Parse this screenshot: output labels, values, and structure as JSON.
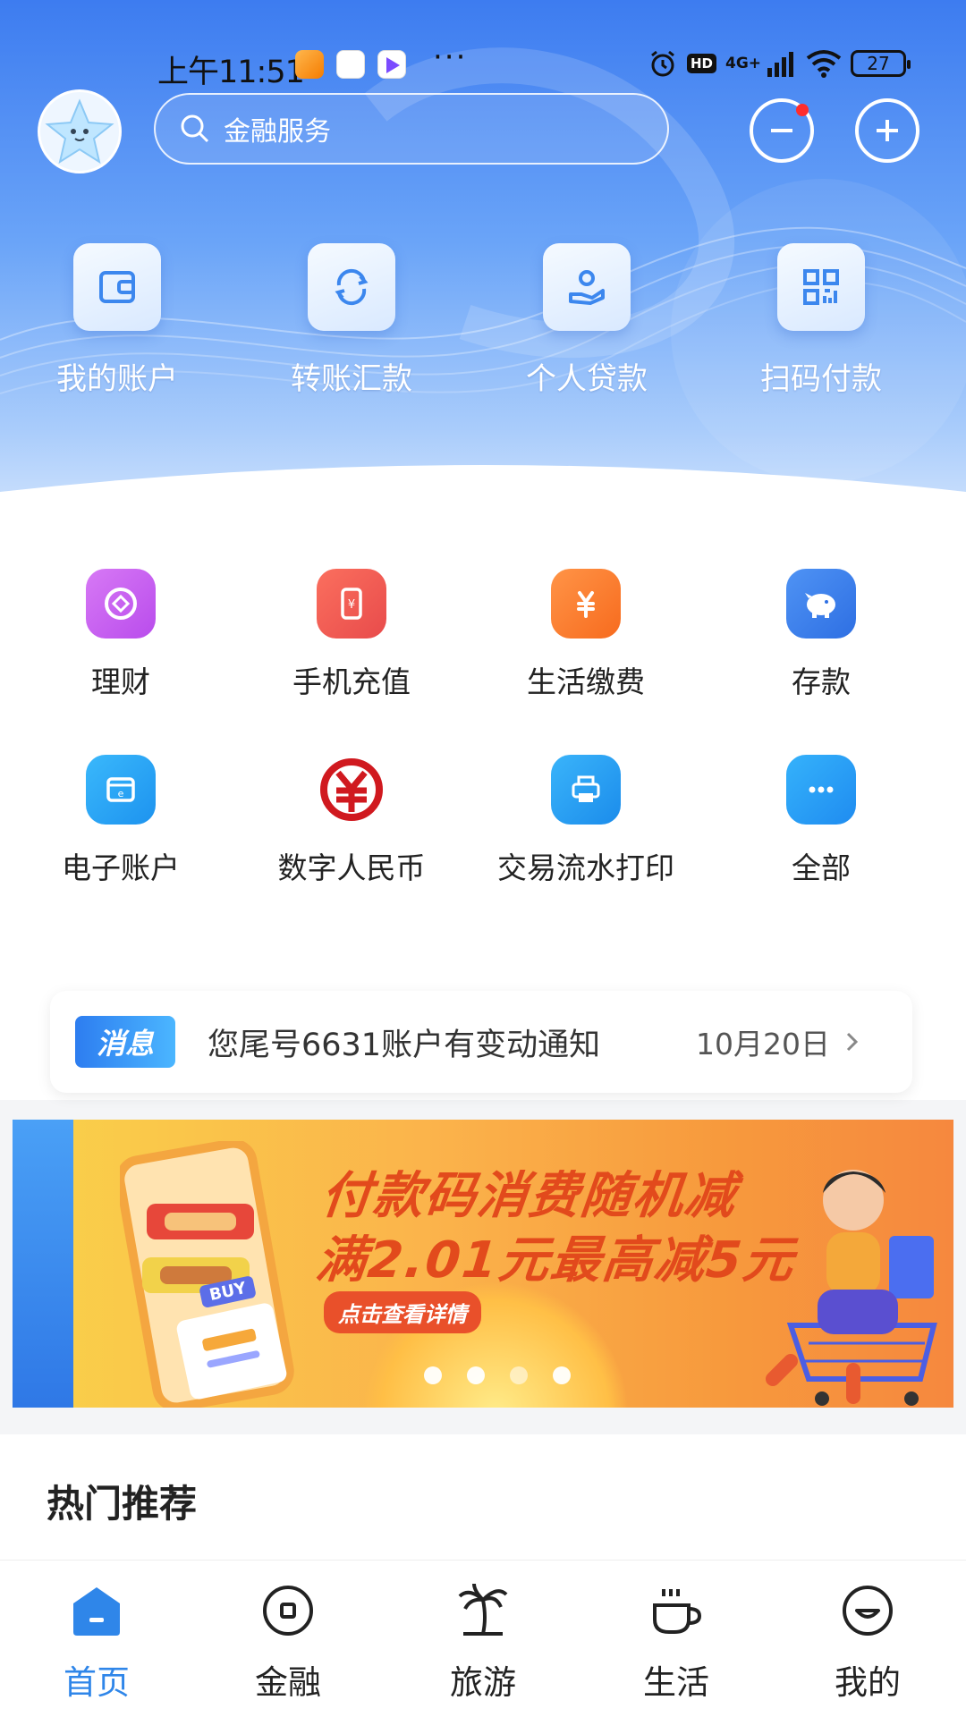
{
  "status_bar": {
    "time": "上午11:51",
    "more": "···",
    "hd": "HD",
    "network": "4G+",
    "battery": "27"
  },
  "header": {
    "search_placeholder": "金融服务"
  },
  "quick_actions": [
    {
      "label": "我的账户",
      "icon": "wallet-icon"
    },
    {
      "label": "转账汇款",
      "icon": "transfer-icon"
    },
    {
      "label": "个人贷款",
      "icon": "loan-icon"
    },
    {
      "label": "扫码付款",
      "icon": "qr-code-icon"
    }
  ],
  "services": [
    {
      "label": "理财",
      "icon": "wealth-icon",
      "color": "#c85df0"
    },
    {
      "label": "手机充值",
      "icon": "phone-recharge-icon",
      "color": "#f15a4f"
    },
    {
      "label": "生活缴费",
      "icon": "bill-payment-icon",
      "color": "#fb7a2c"
    },
    {
      "label": "存款",
      "icon": "piggy-bank-icon",
      "color": "#3a7ff0"
    },
    {
      "label": "电子账户",
      "icon": "e-account-icon",
      "color": "#27a4f5"
    },
    {
      "label": "数字人民币",
      "icon": "digital-rmb-icon",
      "color": "#d0191f"
    },
    {
      "label": "交易流水打印",
      "icon": "printer-icon",
      "color": "#2b9df3"
    },
    {
      "label": "全部",
      "icon": "more-dots-icon",
      "color": "#2196f3"
    }
  ],
  "message": {
    "tag": "消息",
    "text": "您尾号6631账户有变动通知",
    "date": "10月20日"
  },
  "banner": {
    "line1": "付款码消费随机减",
    "line2": "满2.01元最高减5元",
    "cta": "点击查看详情",
    "buy_label": "BUY",
    "slide_count": 4,
    "active_slide": 3
  },
  "hot": {
    "title": "热门推荐"
  },
  "bottom_nav": [
    {
      "label": "首页",
      "icon": "home-icon",
      "active": true
    },
    {
      "label": "金融",
      "icon": "finance-icon",
      "active": false
    },
    {
      "label": "旅游",
      "icon": "palm-tree-icon",
      "active": false
    },
    {
      "label": "生活",
      "icon": "coffee-cup-icon",
      "active": false
    },
    {
      "label": "我的",
      "icon": "smile-face-icon",
      "active": false
    }
  ],
  "colors": {
    "primary": "#2f86e9",
    "header_gradient_top": "#3d7cf0",
    "banner_text": "#e24a1c"
  }
}
